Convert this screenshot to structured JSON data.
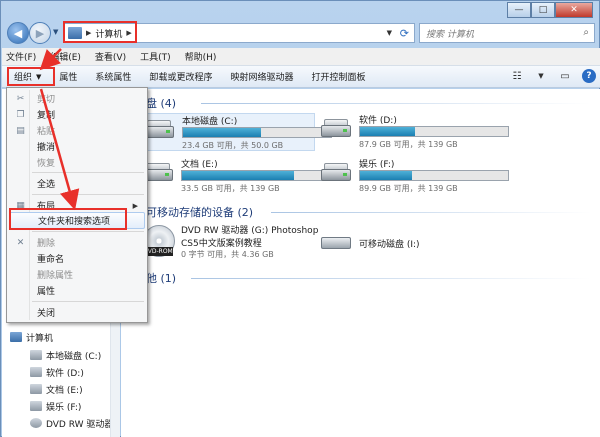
{
  "window": {
    "caption_min": "—",
    "caption_max": "□",
    "caption_close": "✕"
  },
  "address": {
    "crumb": "计算机",
    "search_placeholder": "搜索 计算机"
  },
  "menubar": [
    "文件(F)",
    "编辑(E)",
    "查看(V)",
    "工具(T)",
    "帮助(H)"
  ],
  "cmdbar": {
    "organize": "组织",
    "items": [
      "属性",
      "系统属性",
      "卸载或更改程序",
      "映射网络驱动器",
      "打开控制面板"
    ]
  },
  "context_menu": {
    "items": [
      {
        "label": "剪切",
        "disabled": true,
        "icon": "scissors-icon"
      },
      {
        "label": "复制",
        "disabled": false,
        "icon": "copy-icon"
      },
      {
        "label": "粘贴",
        "disabled": true,
        "icon": "paste-icon"
      },
      {
        "label": "撤消",
        "disabled": false
      },
      {
        "label": "恢复",
        "disabled": true
      },
      {
        "label": "全选",
        "disabled": false
      },
      {
        "label": "布局",
        "disabled": false,
        "icon": "layout-icon",
        "submenu": true
      },
      {
        "label": "文件夹和搜索选项",
        "disabled": false
      },
      {
        "label": "删除",
        "disabled": true,
        "icon": "delete-icon"
      },
      {
        "label": "重命名",
        "disabled": false
      },
      {
        "label": "删除属性",
        "disabled": true
      },
      {
        "label": "属性",
        "disabled": false
      },
      {
        "label": "关闭",
        "disabled": false
      }
    ]
  },
  "nav": {
    "computer": "计算机",
    "drives": [
      "本地磁盘 (C:)",
      "软件 (D:)",
      "文档 (E:)",
      "娱乐 (F:)",
      "DVD RW 驱动器"
    ]
  },
  "content": {
    "group_hdd": "硬盘 (4)",
    "group_removable": "有可移动存储的设备 (2)",
    "group_other": "其他 (1)",
    "drives": [
      {
        "name": "本地磁盘 (C:)",
        "info": "23.4 GB 可用，共 50.0 GB",
        "used_fraction": 0.53
      },
      {
        "name": "软件 (D:)",
        "info": "87.9 GB 可用，共 139 GB",
        "used_fraction": 0.37
      },
      {
        "name": "文档 (E:)",
        "info": "33.5 GB 可用，共 139 GB",
        "used_fraction": 0.76
      },
      {
        "name": "娱乐 (F:)",
        "info": "89.9 GB 可用，共 139 GB",
        "used_fraction": 0.35
      }
    ],
    "dvd": {
      "name": "DVD RW 驱动器 (G:) Photoshop",
      "name2": "CS5中文版案例教程",
      "info": "0 字节 可用，共 4.36 GB",
      "tag": "DVD-ROM"
    },
    "usb": {
      "name": "可移动磁盘 (I:)"
    }
  },
  "colors": {
    "highlight": "#e8302a",
    "bar_fill": "#1b7fb1"
  }
}
